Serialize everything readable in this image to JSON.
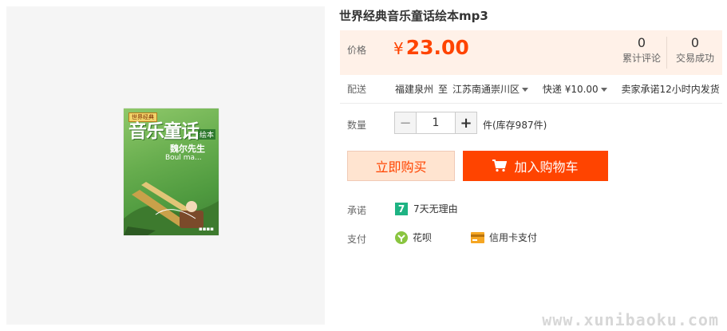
{
  "product": {
    "title": "世界经典音乐童话绘本mp3",
    "cover": {
      "badge": "世界经典",
      "title": "音乐童话",
      "subtitle": "绘本",
      "story_cn": "魏尔先生",
      "story_en": "Boul ma..."
    }
  },
  "price": {
    "label": "价格",
    "currency": "¥",
    "value": "23.00"
  },
  "stats": [
    {
      "count": "0",
      "label": "累计评论"
    },
    {
      "count": "0",
      "label": "交易成功"
    }
  ],
  "shipping": {
    "label": "配送",
    "from": "福建泉州",
    "to_word": "至",
    "destination": "江苏南通崇川区",
    "method": "快递 ¥10.00",
    "promise": "卖家承诺12小时内发货"
  },
  "quantity": {
    "label": "数量",
    "minus": "−",
    "value": "1",
    "plus": "+",
    "stock": "件(库存987件)"
  },
  "buttons": {
    "buy_now": "立即购买",
    "add_to_cart": "加入购物车"
  },
  "promise": {
    "label": "承诺",
    "badge": "7",
    "text": "7天无理由"
  },
  "payment": {
    "label": "支付",
    "methods": [
      {
        "label": "花呗",
        "icon": "huabei-icon"
      },
      {
        "label": "信用卡支付",
        "icon": "credit-card-icon"
      }
    ]
  },
  "watermark": "www.xunibaoku.com",
  "colors": {
    "accent": "#ff4400",
    "price_bg": "#fff1e8",
    "buy_bg": "#ffe4d0",
    "promise_green": "#1eb383"
  }
}
